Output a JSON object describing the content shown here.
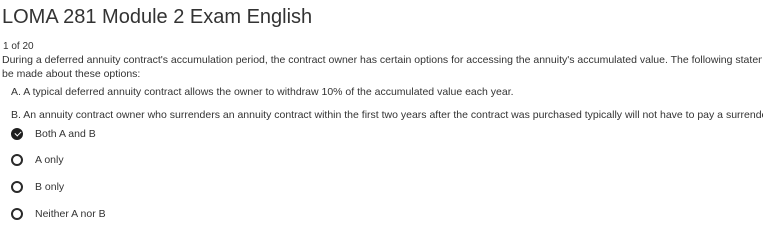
{
  "header": {
    "title": "LOMA 281 Module 2 Exam English"
  },
  "question": {
    "counter": "1 of 20",
    "prompt_lines": [
      "During a deferred annuity contract's accumulation period, the contract owner has certain options for accessing the annuity's accumulated value. The following statement(s) can c",
      "be made about these options:"
    ],
    "statements": {
      "a": "A. A typical deferred annuity contract allows the owner to withdraw 10% of the accumulated value each year.",
      "b": "B. An annuity contract owner who surrenders an annuity contract within the first two years after the contract was purchased typically will not have to pay a surrender charge"
    }
  },
  "options": [
    {
      "label": "Both A and B",
      "selected": true
    },
    {
      "label": "A only",
      "selected": false
    },
    {
      "label": "B only",
      "selected": false
    },
    {
      "label": "Neither A nor B",
      "selected": false
    }
  ],
  "colors": {
    "text": "#333333",
    "radio_border": "#2a2a2a",
    "radio_selected": "#1f1f1f"
  },
  "icons": {
    "selected_radio": "check-icon"
  }
}
